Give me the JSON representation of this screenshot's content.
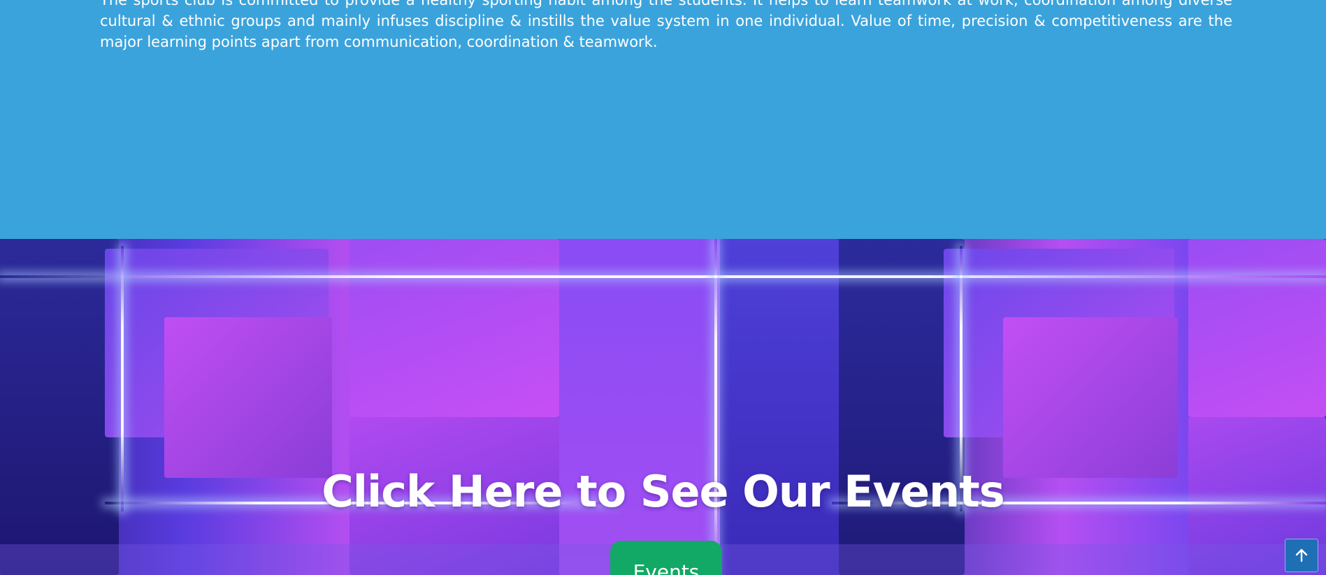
{
  "about": {
    "text": "The sports club is committed to provide a healthy sporting habit among the students. It helps to learn teamwork at work, coordination among diverse cultural & ethnic groups and mainly infuses discipline & instills the value system in one individual. Value of time, precision & competitiveness are the major learning points apart from communication, coordination & teamwork.",
    "background_color": "#3ba3dc"
  },
  "events_banner": {
    "title": "Click Here to See Our Events",
    "button_label": "Events",
    "button_color": "#12a866"
  },
  "scroll_top": {
    "icon": "arrow-up-icon",
    "color": "#1f6fb5"
  }
}
